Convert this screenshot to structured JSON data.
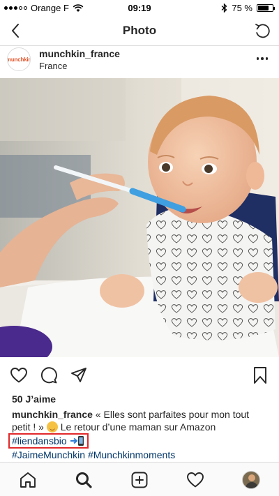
{
  "status_bar": {
    "carrier": "Orange F",
    "time": "09:19",
    "battery_text": "75 %",
    "battery_level": 0.75
  },
  "nav": {
    "title": "Photo",
    "back_icon": "chevron-left-icon",
    "refresh_icon": "refresh-icon"
  },
  "post": {
    "username": "munchkin_france",
    "location": "France",
    "avatar_text": "munchkin",
    "likes": "50 J’aime",
    "caption": {
      "user": "munchkin_france",
      "text_line1": "« Elles sont parfaites pour mon tout petit ! »",
      "text_line2": "Le retour d’une maman sur Amazon",
      "hashtag_highlight": "#liendansbio",
      "hashtags": "#JaimeMunchkin #Munchkinmoments"
    }
  },
  "colors": {
    "accent_link": "#003569",
    "highlight_box": "#e1282b",
    "spoon_blue": "#3f9fe0"
  }
}
